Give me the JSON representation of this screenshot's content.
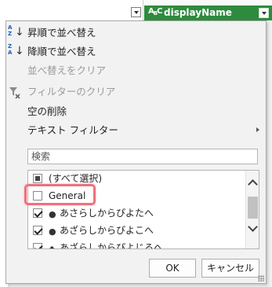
{
  "column_header": {
    "type_icon_main": "A",
    "type_icon_sub": "B",
    "type_icon_tail": "C",
    "name": "displayName",
    "accent_color": "#2e8b3e"
  },
  "menu": {
    "sort_asc": {
      "label": "昇順で並べ替え",
      "icon": "sort-ascending-icon"
    },
    "sort_desc": {
      "label": "降順で並べ替え",
      "icon": "sort-descending-icon"
    },
    "clear_sort": {
      "label": "並べ替えをクリア"
    },
    "clear_filter": {
      "label": "フィルターのクリア",
      "icon": "clear-filter-icon"
    },
    "remove_empty": {
      "label": "空の削除"
    },
    "text_filter": {
      "label": "テキスト フィルター"
    }
  },
  "search": {
    "placeholder": "検索"
  },
  "values": [
    {
      "label": "(すべて選択)",
      "state": "partial"
    },
    {
      "label": "General",
      "state": "unchecked",
      "highlighted": true
    },
    {
      "label": "あさらしからぴよたへ",
      "state": "checked",
      "icon": "emoji-icon"
    },
    {
      "label": "あざらしからぴよこへ",
      "state": "checked",
      "icon": "emoji-icon"
    },
    {
      "label": "あざらしからぴよじろへ",
      "state": "checked",
      "icon": "emoji-icon"
    }
  ],
  "buttons": {
    "ok": "OK",
    "cancel": "キャンセル"
  },
  "colors": {
    "highlight": "#f0707e",
    "link": "#1a5fb4"
  }
}
